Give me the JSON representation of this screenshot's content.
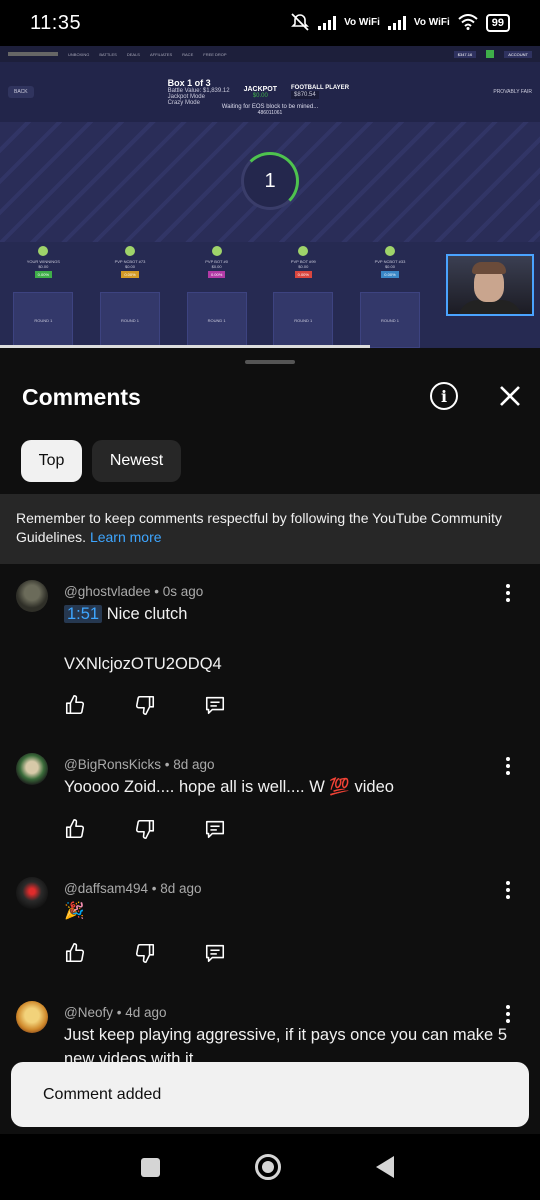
{
  "status_bar": {
    "time": "11:35",
    "vowifi_1": "Vo WiFi",
    "vowifi_2": "Vo WiFi",
    "battery": "99"
  },
  "video": {
    "site_nav": [
      "UNBOXING",
      "BATTLES",
      "DEALS",
      "AFFILIATES",
      "RACE",
      "FREE DROP"
    ],
    "balance": "$347.16",
    "account_label": "ACCOUNT",
    "back_label": "BACK",
    "box_title": "Box 1 of 3",
    "battle_value": "Battle Value: $1,839.12",
    "mode_1": "Jackpot Mode",
    "mode_2": "Crazy Mode",
    "jackpot_label": "JACKPOT",
    "jackpot_value": "$0.00",
    "item_name": "FOOTBALL PLAYER",
    "item_value": "$870.54",
    "provably_fair": "PROVABLY FAIR",
    "waiting_text": "Waiting for EOS block to be mined...",
    "block_number": "486011061",
    "countdown": "1",
    "players": [
      {
        "name": "YOUR WINNINGS",
        "value": "$0.00",
        "pct": "0.00%",
        "pct_color": "#3fae49",
        "round": "ROUND 1"
      },
      {
        "name": "PVP NCBOT #73",
        "value": "$0.00",
        "pct": "0.00%",
        "pct_color": "#d39a26",
        "round": "ROUND 1"
      },
      {
        "name": "PVP BOT #0",
        "value": "$0.00",
        "pct": "0.00%",
        "pct_color": "#b23aa6",
        "round": "ROUND 1"
      },
      {
        "name": "PVP BOT #99",
        "value": "$0.00",
        "pct": "0.00%",
        "pct_color": "#d9463f",
        "round": "ROUND 1"
      },
      {
        "name": "PVP NCBOT #33",
        "value": "$0.00",
        "pct": "0.00%",
        "pct_color": "#3a86c6",
        "round": "ROUND 1"
      }
    ],
    "progress_fraction": 0.685
  },
  "sheet": {
    "title": "Comments",
    "chips": {
      "top": "Top",
      "newest": "Newest"
    },
    "guidelines_text": "Remember to keep comments respectful by following the YouTube Community Guidelines.",
    "guidelines_link": "Learn more"
  },
  "comments": [
    {
      "handle": "@ghostvladee",
      "age": "0s ago",
      "timestamp": "1:51",
      "text": "Nice clutch",
      "text2": "VXNlcjozOTU2ODQ4"
    },
    {
      "handle": "@BigRonsKicks",
      "age": "8d ago",
      "text": "Yooooo Zoid.... hope all is well.... W 💯 video"
    },
    {
      "handle": "@daffsam494",
      "age": "8d ago",
      "text": "🎉"
    },
    {
      "handle": "@Neofy",
      "age": "4d ago",
      "text": "Just keep playing aggressive, if it pays once you can make 5 new videos with it"
    }
  ],
  "toast": {
    "text": "Comment added"
  },
  "colors": {
    "accent_link": "#3ea6ff",
    "sheet_bg": "#0f0f0f",
    "chip_active": "#f1f1f1"
  }
}
